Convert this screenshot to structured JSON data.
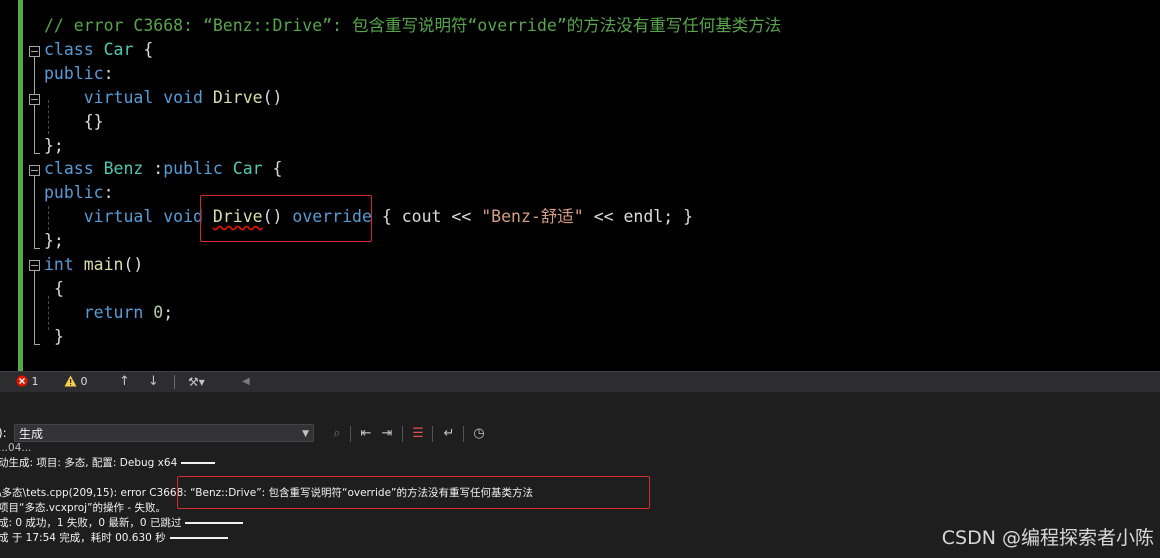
{
  "editor": {
    "comment": "// error C3668: “Benz::Drive”: 包含重写说明符“override”的方法没有重写任何基类方法",
    "lines": [
      {
        "kw": "class",
        "name": "Car",
        "rest": " {"
      },
      {
        "kw": "public",
        "rest": ":"
      },
      {
        "kw1": "virtual",
        "kw2": "void",
        "fn": "Dirve",
        "rest": "()"
      },
      {
        "rest": "{}"
      },
      {
        "rest": "};"
      },
      {
        "kw": "class",
        "name": "Benz",
        "mid1": " :",
        "kw2": "public",
        "base": "Car",
        "rest": " {"
      },
      {
        "kw": "public",
        "rest": ":"
      },
      {
        "kw1": "virtual",
        "kw2": "void",
        "fn": "Drive",
        "paren": "()",
        "spec": "override",
        "b1": "{",
        "cout": "cout",
        "op1": "<<",
        "str": "\"Benz-舒适\"",
        "op2": "<<",
        "endl": "endl;",
        "b2": "}"
      },
      {
        "rest": "};"
      },
      {
        "kw": "int",
        "fn": "main",
        "rest": "()"
      },
      {
        "rest": "{"
      },
      {
        "kw": "return",
        "num": "0",
        "rest": ";"
      },
      {
        "rest": "}"
      }
    ]
  },
  "error_bar": {
    "errors": "1",
    "warnings": "0"
  },
  "output": {
    "source_label": "):",
    "source_value": "生成",
    "lines": [
      "...04...",
      "动生成: 项目: 多态, 配置: Debug x64",
      "",
      "\\多态\\tets.cpp(209,15): error C3668: “Benz::Drive”: 包含重写说明符“override”的方法没有重写任何基类方法",
      "项目“多态.vcxproj”的操作 - 失败。",
      "成: 0 成功，1 失败，0 最新，0 已跳过",
      "成 于 17:54 完成，耗时 00.630 秒"
    ]
  },
  "watermark": "CSDN @编程探索者小陈",
  "colors": {
    "editor_bg": "#000000",
    "keyword": "#569cd6",
    "type": "#4ec9b0",
    "function": "#dcdcaa",
    "string": "#d69d85",
    "comment": "#57a64a",
    "highlight_box": "#d42c2c"
  }
}
